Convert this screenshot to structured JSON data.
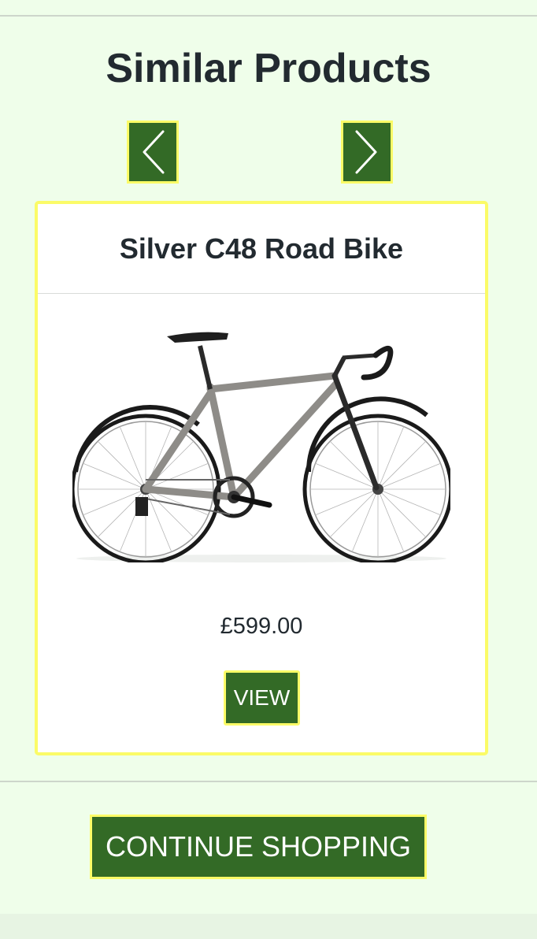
{
  "similar_products": {
    "title": "Similar Products",
    "prev_icon": "chevron-left-icon",
    "next_icon": "chevron-right-icon",
    "product": {
      "name": "Silver C48 Road Bike",
      "price": "£599.00",
      "view_label": "VIEW",
      "image_icon": "road-bike-image"
    }
  },
  "continue_label": "CONTINUE SHOPPING",
  "colors": {
    "page_background": "#effeea",
    "button_green": "#336a26",
    "highlight_yellow": "#fbfb67",
    "heading_text": "#222a30"
  }
}
